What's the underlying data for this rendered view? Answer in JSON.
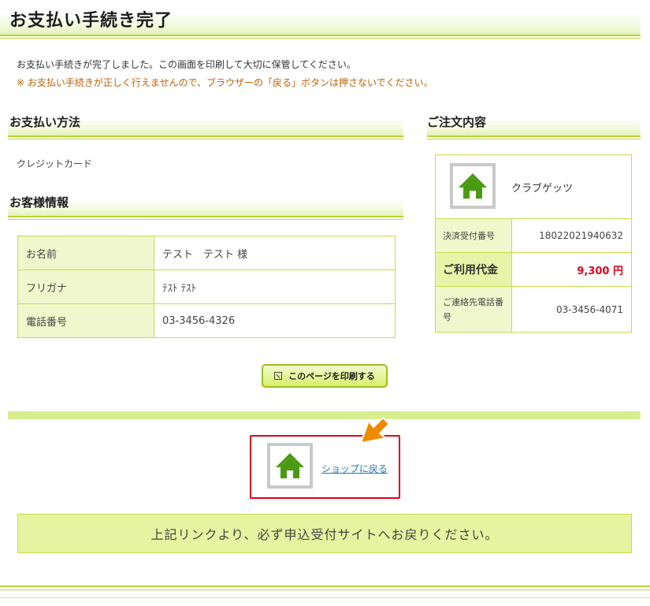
{
  "page": {
    "title": "お支払い手続き完了",
    "intro": "お支払い手続きが完了しました。この画面を印刷して大切に保管してください。",
    "warning": "※ お支払い手続きが正しく行えませんので、ブラウザーの「戻る」ボタンは押さないでください。"
  },
  "payment": {
    "heading": "お支払い方法",
    "method": "クレジットカード"
  },
  "customer": {
    "heading": "お客様情報",
    "rows": [
      {
        "label": "お名前",
        "value": "テスト　テスト 様"
      },
      {
        "label": "フリガナ",
        "value": "ﾃｽﾄ ﾃｽﾄ"
      },
      {
        "label": "電話番号",
        "value": "03-3456-4326"
      }
    ]
  },
  "order": {
    "heading": "ご注文内容",
    "shop_name": "クラブゲッツ",
    "rows": [
      {
        "label": "決済受付番号",
        "value": "18022021940632"
      },
      {
        "label": "ご利用代金",
        "value": "9,300 円"
      },
      {
        "label": "ご連絡先電話番号",
        "value": "03-3456-4071"
      }
    ]
  },
  "actions": {
    "print_label": "このページを印刷する",
    "back_link": "ショップに戻る"
  },
  "notice": "上記リンクより、必ず申込受付サイトへお戻りください。",
  "colors": {
    "accent_green": "#b8d63a",
    "warning_text": "#c06000",
    "price_red": "#e0001a",
    "highlight_border": "#e0001a",
    "arrow_orange": "#f08a00",
    "house_green": "#4a9a12"
  }
}
